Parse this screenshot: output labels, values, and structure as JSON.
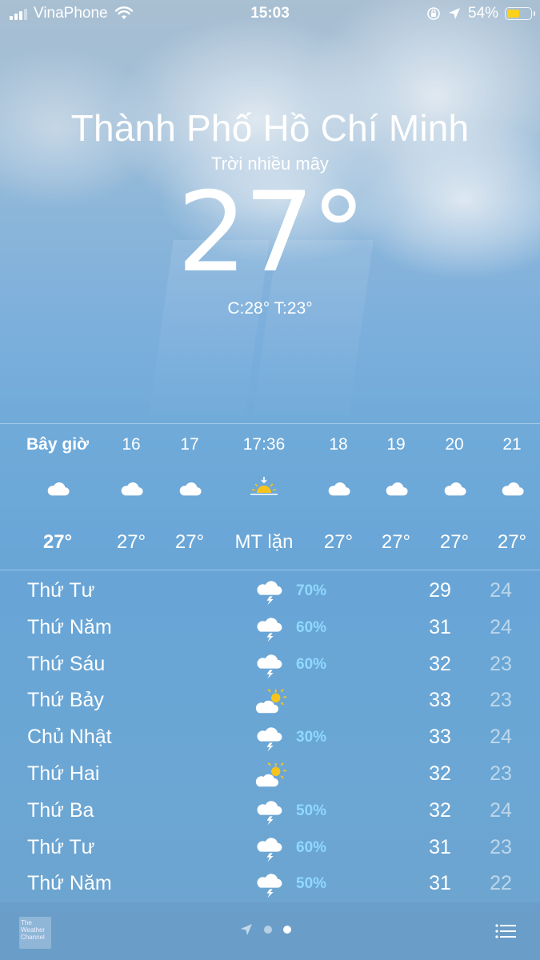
{
  "status_bar": {
    "carrier": "VinaPhone",
    "time": "15:03",
    "battery_percent": "54%",
    "battery_level": 0.54,
    "icons": [
      "signal-icon",
      "wifi-icon",
      "orientation-lock-icon",
      "location-arrow-icon",
      "battery-icon"
    ]
  },
  "current": {
    "city": "Thành Phố Hồ Chí Minh",
    "condition": "Trời nhiều mây",
    "temperature": "27°",
    "hi_lo": "C:28°  T:23°"
  },
  "hourly": [
    {
      "label": "Bây giờ",
      "icon": "cloud-icon",
      "temp": "27°",
      "now": true
    },
    {
      "label": "16",
      "icon": "cloud-icon",
      "temp": "27°"
    },
    {
      "label": "17",
      "icon": "cloud-icon",
      "temp": "27°"
    },
    {
      "label": "17:36",
      "icon": "sunset-icon",
      "temp": "MT lặn"
    },
    {
      "label": "18",
      "icon": "cloud-icon",
      "temp": "27°"
    },
    {
      "label": "19",
      "icon": "cloud-icon",
      "temp": "27°"
    },
    {
      "label": "20",
      "icon": "cloud-icon",
      "temp": "27°"
    },
    {
      "label": "21",
      "icon": "cloud-icon",
      "temp": "27°"
    }
  ],
  "daily": [
    {
      "day": "Thứ Tư",
      "icon": "thunderstorm-icon",
      "prob": "70%",
      "hi": "29",
      "lo": "24"
    },
    {
      "day": "Thứ Năm",
      "icon": "thunderstorm-icon",
      "prob": "60%",
      "hi": "31",
      "lo": "24"
    },
    {
      "day": "Thứ Sáu",
      "icon": "thunderstorm-icon",
      "prob": "60%",
      "hi": "32",
      "lo": "23"
    },
    {
      "day": "Thứ Bảy",
      "icon": "partly-sunny-icon",
      "prob": "",
      "hi": "33",
      "lo": "23"
    },
    {
      "day": "Chủ Nhật",
      "icon": "thunderstorm-icon",
      "prob": "30%",
      "hi": "33",
      "lo": "24"
    },
    {
      "day": "Thứ Hai",
      "icon": "partly-sunny-icon",
      "prob": "",
      "hi": "32",
      "lo": "23"
    },
    {
      "day": "Thứ Ba",
      "icon": "thunderstorm-icon",
      "prob": "50%",
      "hi": "32",
      "lo": "24"
    },
    {
      "day": "Thứ Tư",
      "icon": "thunderstorm-icon",
      "prob": "60%",
      "hi": "31",
      "lo": "23"
    },
    {
      "day": "Thứ Năm",
      "icon": "thunderstorm-icon",
      "prob": "50%",
      "hi": "31",
      "lo": "22"
    }
  ],
  "bottom_bar": {
    "logo_text": "The Weather Channel",
    "pages": 2,
    "active_page": 2
  },
  "colors": {
    "probability": "#8fd9ff",
    "battery_fill": "#f8d21c",
    "sun": "#f8c41c"
  }
}
